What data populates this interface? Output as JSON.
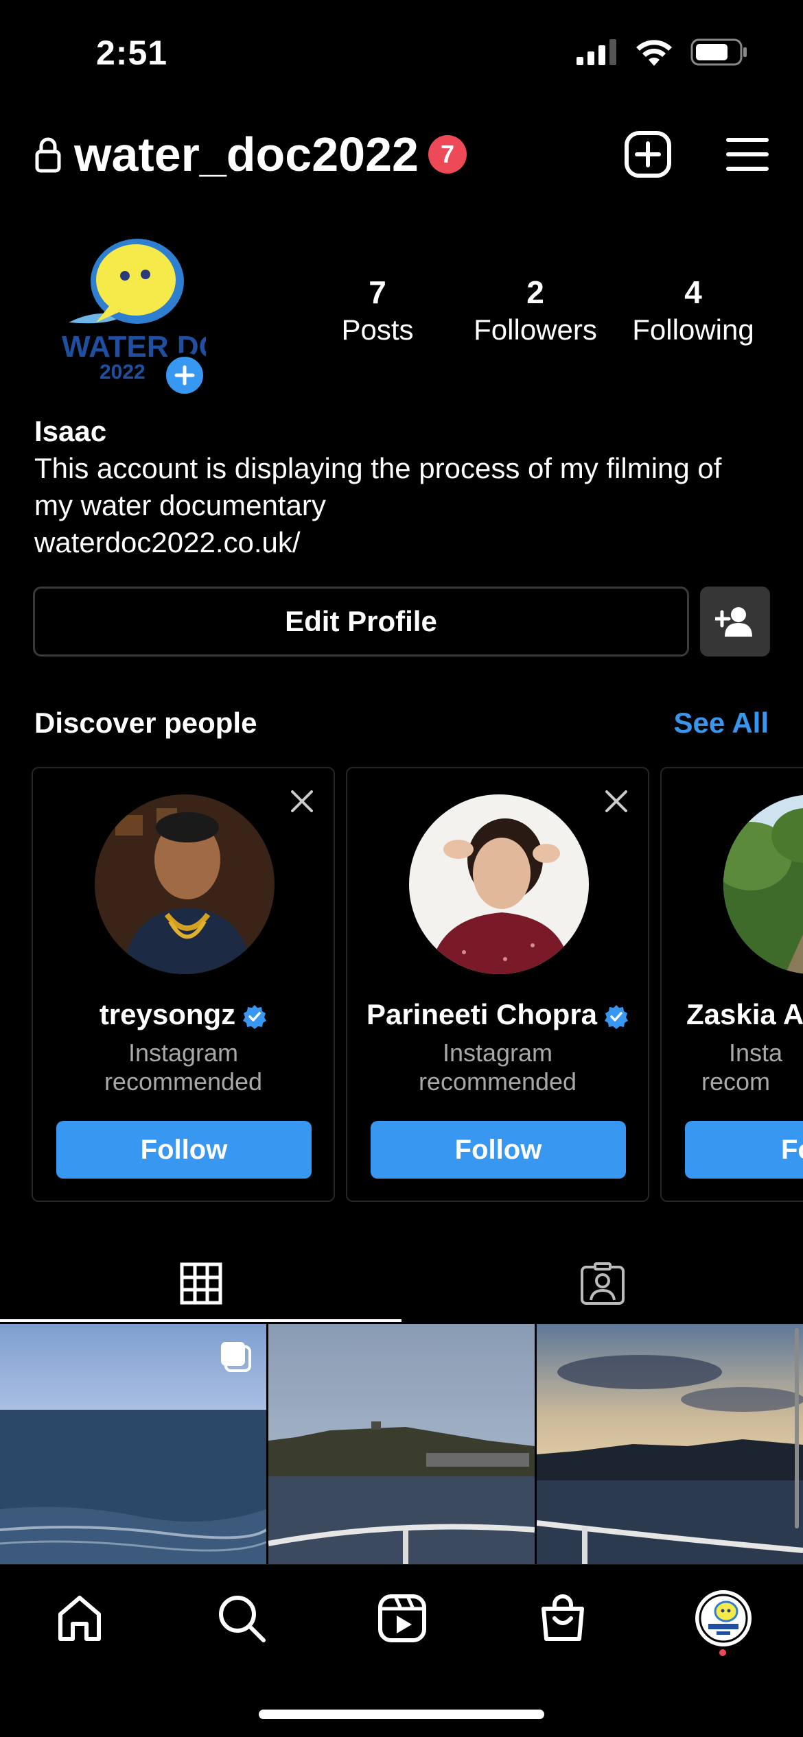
{
  "status_bar": {
    "time": "2:51"
  },
  "header": {
    "username": "water_doc2022",
    "notification_count": "7"
  },
  "profile": {
    "avatar_logo_text": [
      "WATER DOC",
      "2022"
    ],
    "stats": [
      {
        "value": "7",
        "label": "Posts"
      },
      {
        "value": "2",
        "label": "Followers"
      },
      {
        "value": "4",
        "label": "Following"
      }
    ],
    "name": "Isaac",
    "bio_line1": "This account is displaying the process of my filming of",
    "bio_line2": "my water documentary",
    "link": "waterdoc2022.co.uk/",
    "edit_label": "Edit Profile"
  },
  "discover": {
    "title": "Discover people",
    "see_all": "See All",
    "cards": [
      {
        "name": "treysongz",
        "verified": true,
        "subtitle_1": "Instagram",
        "subtitle_2": "recommended",
        "button": "Follow"
      },
      {
        "name": "Parineeti Chopra",
        "verified": true,
        "subtitle_1": "Instagram",
        "subtitle_2": "recommended",
        "button": "Follow"
      },
      {
        "name": "Zaskia A",
        "verified": false,
        "subtitle_1": "Insta",
        "subtitle_2": "recom",
        "button": "Fo"
      }
    ]
  },
  "colors": {
    "accent": "#3897f0",
    "badge": "#ed4956",
    "background": "#000000"
  },
  "bottom_nav": [
    "home-icon",
    "search-icon",
    "reels-icon",
    "shop-icon",
    "profile-avatar"
  ]
}
